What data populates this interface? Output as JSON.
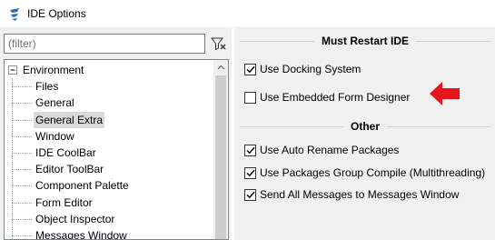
{
  "window": {
    "title": "IDE Options"
  },
  "filter": {
    "placeholder": "(filter)",
    "value": ""
  },
  "tree": {
    "root": "Environment",
    "items": [
      {
        "label": "Files",
        "selected": false
      },
      {
        "label": "General",
        "selected": false
      },
      {
        "label": "General Extra",
        "selected": true
      },
      {
        "label": "Window",
        "selected": false
      },
      {
        "label": "IDE CoolBar",
        "selected": false
      },
      {
        "label": "Editor ToolBar",
        "selected": false
      },
      {
        "label": "Component Palette",
        "selected": false
      },
      {
        "label": "Form Editor",
        "selected": false
      },
      {
        "label": "Object Inspector",
        "selected": false
      },
      {
        "label": "Messages Window",
        "selected": false
      }
    ]
  },
  "groups": {
    "must_restart": {
      "title": "Must Restart IDE",
      "options": [
        {
          "label": "Use Docking System",
          "checked": true
        },
        {
          "label": "Use Embedded Form Designer",
          "checked": false
        }
      ]
    },
    "other": {
      "title": "Other",
      "options": [
        {
          "label": "Use Auto Rename Packages",
          "checked": true
        },
        {
          "label": "Use Packages Group Compile (Multithreading)",
          "checked": true
        },
        {
          "label": "Send All Messages to Messages Window",
          "checked": true
        }
      ]
    }
  },
  "colors": {
    "annotation_arrow": "#e8141c",
    "selection": "#d9d9d9"
  },
  "icons": {
    "app": "ide-logo-icon",
    "filter_clear": "filter-clear-icon",
    "annotation": "red-arrow-icon"
  }
}
